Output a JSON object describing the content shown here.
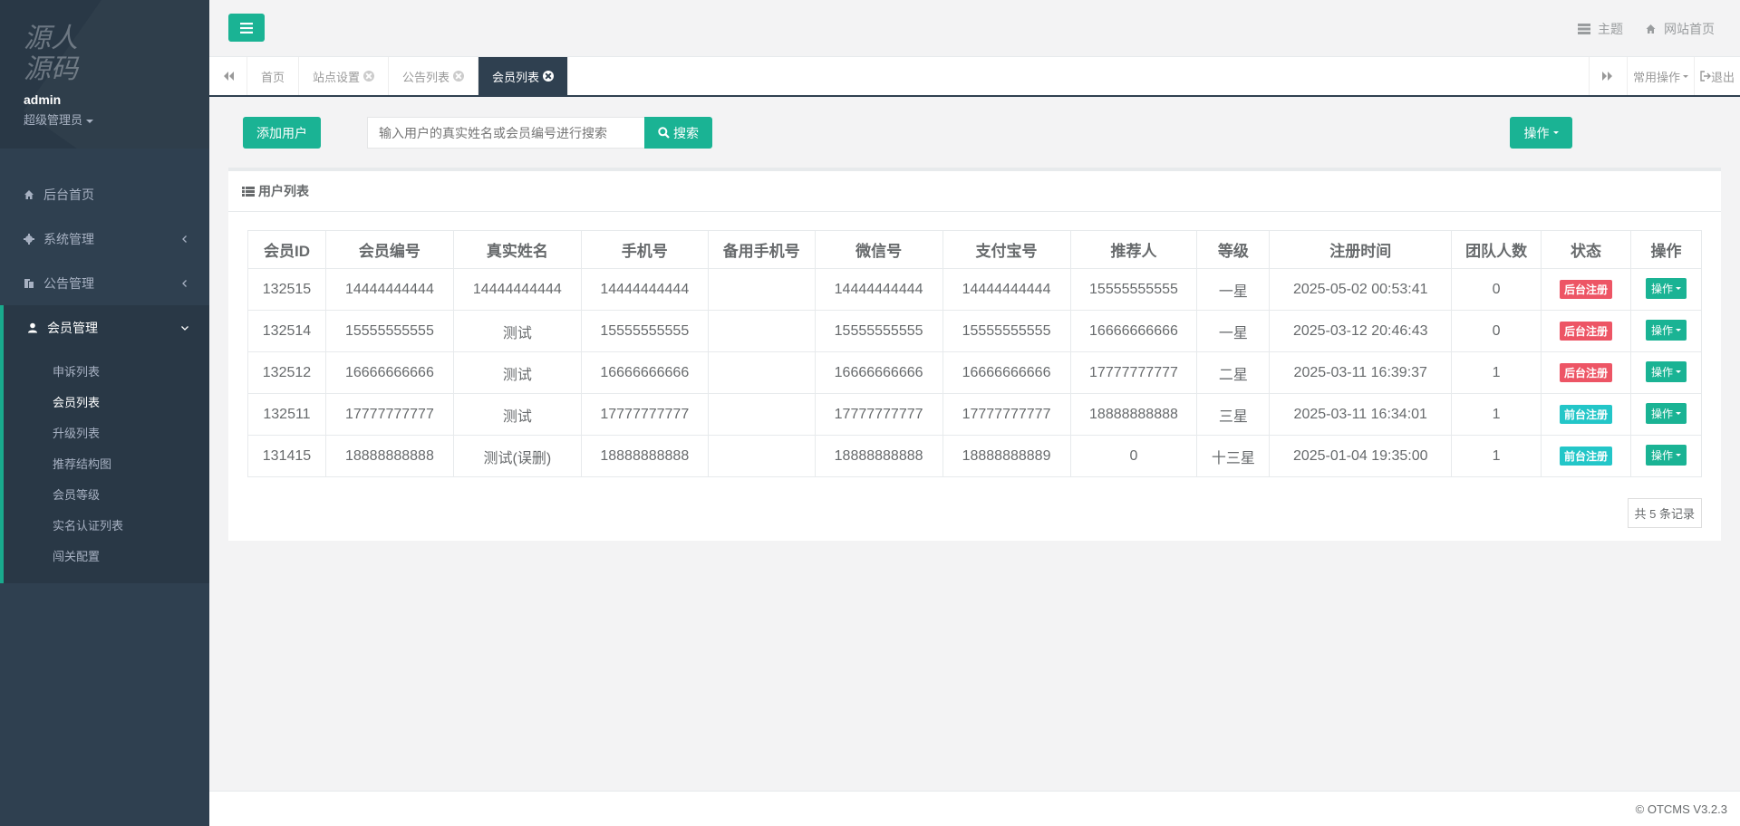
{
  "sidebar": {
    "logo_text": "源人源码",
    "user_name": "admin",
    "user_role": "超级管理员",
    "nav": [
      {
        "label": "后台首页"
      },
      {
        "label": "系统管理"
      },
      {
        "label": "公告管理"
      },
      {
        "label": "会员管理"
      }
    ],
    "subnav": [
      "申诉列表",
      "会员列表",
      "升级列表",
      "推荐结构图",
      "会员等级",
      "实名认证列表",
      "闯关配置"
    ]
  },
  "topbar": {
    "theme_label": "主题",
    "home_label": "网站首页"
  },
  "tabs": {
    "items": [
      "首页",
      "站点设置",
      "公告列表",
      "会员列表"
    ],
    "common_ops": "常用操作",
    "logout": "退出"
  },
  "toolbar": {
    "add_label": "添加用户",
    "search_placeholder": "输入用户的真实姓名或会员编号进行搜索",
    "search_label": "搜索",
    "op_label": "操作"
  },
  "panel": {
    "title": "用户列表"
  },
  "table": {
    "headers": [
      "会员ID",
      "会员编号",
      "真实姓名",
      "手机号",
      "备用手机号",
      "微信号",
      "支付宝号",
      "推荐人",
      "等级",
      "注册时间",
      "团队人数",
      "状态",
      "操作"
    ],
    "rows": [
      {
        "id": "132515",
        "no": "14444444444",
        "name": "14444444444",
        "phone": "14444444444",
        "alt": "",
        "wx": "14444444444",
        "alipay": "14444444444",
        "ref": "15555555555",
        "level": "一星",
        "time": "2025-05-02 00:53:41",
        "team": "0",
        "status": "后台注册",
        "status_color": "#ed5565",
        "op": "操作"
      },
      {
        "id": "132514",
        "no": "15555555555",
        "name": "测试",
        "phone": "15555555555",
        "alt": "",
        "wx": "15555555555",
        "alipay": "15555555555",
        "ref": "16666666666",
        "level": "一星",
        "time": "2025-03-12 20:46:43",
        "team": "0",
        "status": "后台注册",
        "status_color": "#ed5565",
        "op": "操作"
      },
      {
        "id": "132512",
        "no": "16666666666",
        "name": "测试",
        "phone": "16666666666",
        "alt": "",
        "wx": "16666666666",
        "alipay": "16666666666",
        "ref": "17777777777",
        "level": "二星",
        "time": "2025-03-11 16:39:37",
        "team": "1",
        "status": "后台注册",
        "status_color": "#ed5565",
        "op": "操作"
      },
      {
        "id": "132511",
        "no": "17777777777",
        "name": "测试",
        "phone": "17777777777",
        "alt": "",
        "wx": "17777777777",
        "alipay": "17777777777",
        "ref": "18888888888",
        "level": "三星",
        "time": "2025-03-11 16:34:01",
        "team": "1",
        "status": "前台注册",
        "status_color": "#23c6c8",
        "op": "操作"
      },
      {
        "id": "131415",
        "no": "18888888888",
        "name": "测试(误删)",
        "phone": "18888888888",
        "alt": "",
        "wx": "18888888888",
        "alipay": "18888888889",
        "ref": "0",
        "level": "十三星",
        "time": "2025-01-04 19:35:00",
        "team": "1",
        "status": "前台注册",
        "status_color": "#23c6c8",
        "op": "操作"
      }
    ],
    "total": "共 5 条记录"
  },
  "footer": {
    "copyright": "© OTCMS V3.2.3"
  },
  "colors": {
    "primary": "#1ab394",
    "sidebar": "#2f4050",
    "danger": "#ed5565",
    "info": "#23c6c8"
  }
}
